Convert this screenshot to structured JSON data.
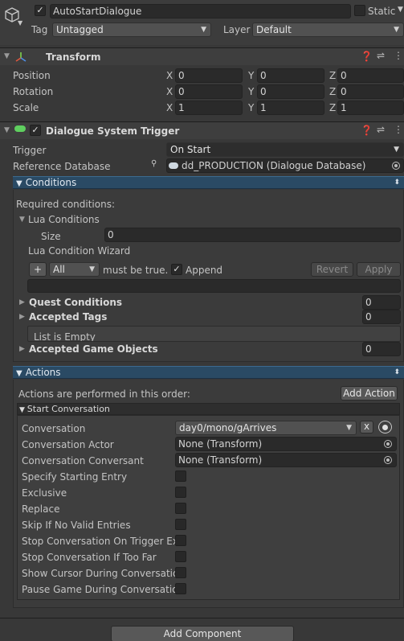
{
  "object": {
    "name": "AutoStartDialogue",
    "static_label": "Static",
    "tag_label": "Tag",
    "tag_value": "Untagged",
    "layer_label": "Layer",
    "layer_value": "Default"
  },
  "transform": {
    "title": "Transform",
    "rows": [
      {
        "label": "Position",
        "x": "0",
        "y": "0",
        "z": "0"
      },
      {
        "label": "Rotation",
        "x": "0",
        "y": "0",
        "z": "0"
      },
      {
        "label": "Scale",
        "x": "1",
        "y": "1",
        "z": "1"
      }
    ],
    "axis": {
      "x": "X",
      "y": "Y",
      "z": "Z"
    }
  },
  "dst": {
    "title": "Dialogue System Trigger",
    "trigger_label": "Trigger",
    "trigger_value": "On Start",
    "refdb_label": "Reference Database",
    "refdb_value": "dd_PRODUCTION (Dialogue Database)"
  },
  "conditions": {
    "title": "Conditions",
    "required": "Required conditions:",
    "lua_conditions": "Lua Conditions",
    "size_label": "Size",
    "size_value": "0",
    "wizard_label": "Lua Condition Wizard",
    "plus": "+",
    "all_value": "All",
    "must_be_true": "must be true.",
    "append": "Append",
    "revert": "Revert",
    "apply": "Apply",
    "quest_conditions": "Quest Conditions",
    "quest_value": "0",
    "accepted_tags": "Accepted Tags",
    "tags_value": "0",
    "list_empty": "List is Empty",
    "accepted_objects": "Accepted Game Objects",
    "objects_value": "0"
  },
  "actions": {
    "title": "Actions",
    "performed": "Actions are performed in this order:",
    "add_action": "Add Action",
    "start_conversation": "Start Conversation",
    "conversation_label": "Conversation",
    "conversation_value": "day0/mono/gArrives",
    "clear_x": "x",
    "actor_label": "Conversation Actor",
    "actor_value": "None (Transform)",
    "conversant_label": "Conversation Conversant",
    "conversant_value": "None (Transform)",
    "toggles": [
      "Specify Starting Entry",
      "Exclusive",
      "Replace",
      "Skip If No Valid Entries",
      "Stop Conversation On Trigger Exit",
      "Stop Conversation If Too Far",
      "Show Cursor During Conversation",
      "Pause Game During Conversation"
    ]
  },
  "footer": {
    "add_component": "Add Component"
  },
  "colors": {
    "background": "#383838",
    "field": "#2a2a2a",
    "blue_bar": "#2a4a64",
    "dst_icon": "#5fcf5f"
  }
}
